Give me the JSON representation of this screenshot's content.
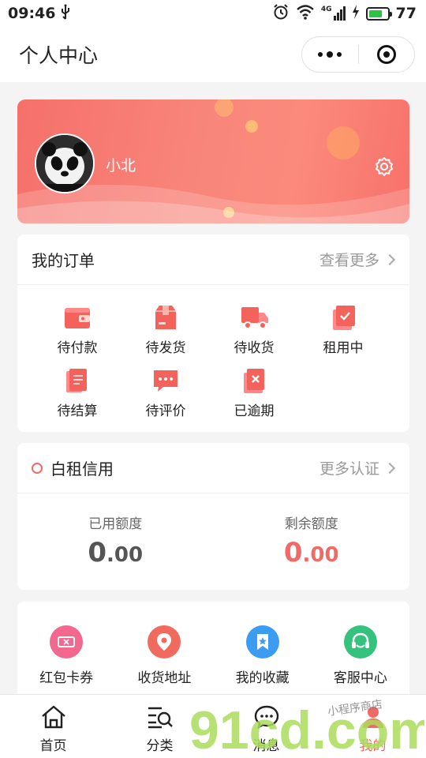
{
  "status_bar": {
    "time": "09:46",
    "battery_level": "77",
    "network": "4G"
  },
  "nav": {
    "title": "个人中心"
  },
  "profile": {
    "username": "小北"
  },
  "orders": {
    "title": "我的订单",
    "more": "查看更多",
    "items": [
      {
        "label": "待付款",
        "icon": "wallet-icon"
      },
      {
        "label": "待发货",
        "icon": "package-icon"
      },
      {
        "label": "待收货",
        "icon": "truck-icon"
      },
      {
        "label": "租用中",
        "icon": "check-doc-icon"
      },
      {
        "label": "待结算",
        "icon": "bill-icon"
      },
      {
        "label": "待评价",
        "icon": "comment-icon"
      },
      {
        "label": "已逾期",
        "icon": "overdue-icon"
      }
    ]
  },
  "credit": {
    "title": "白租信用",
    "more": "更多认证",
    "used_label": "已用额度",
    "used_int": "0",
    "used_dec": ".00",
    "remain_label": "剩余额度",
    "remain_int": "0",
    "remain_dec": ".00"
  },
  "services": [
    {
      "label": "红包卡券",
      "icon": "coupon-icon",
      "color": "#f2688f"
    },
    {
      "label": "收货地址",
      "icon": "location-icon",
      "color": "#f06a5e"
    },
    {
      "label": "我的收藏",
      "icon": "bookmark-icon",
      "color": "#3b9cf2"
    },
    {
      "label": "客服中心",
      "icon": "headset-icon",
      "color": "#35c27d"
    }
  ],
  "tabbar": [
    {
      "label": "首页",
      "icon": "home-icon"
    },
    {
      "label": "分类",
      "icon": "category-search-icon"
    },
    {
      "label": "消息",
      "icon": "message-icon"
    },
    {
      "label": "我的",
      "icon": "user-icon"
    }
  ],
  "watermark": {
    "text": "91cd.com",
    "tagline": "小程序商店"
  },
  "colors": {
    "accent": "#f26a66",
    "banner_start": "#f6706b",
    "banner_end": "#fb8a7c"
  }
}
